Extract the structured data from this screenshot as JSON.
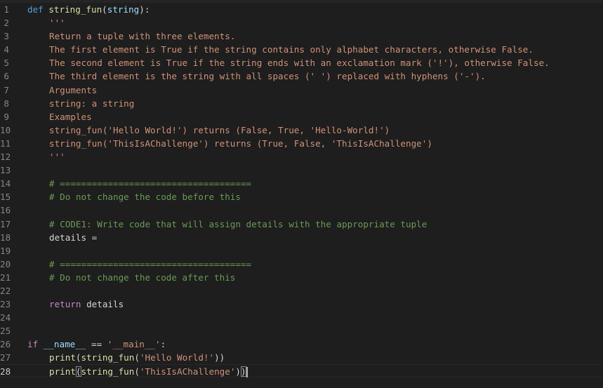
{
  "editor": {
    "language": "python",
    "active_line": 28,
    "colors": {
      "background": "#1e1e1e",
      "keyword": "#569cd6",
      "control_keyword": "#c586c0",
      "function": "#dcdcaa",
      "parameter": "#9cdcfe",
      "string": "#ce9178",
      "comment": "#6a9955",
      "line_number": "#858585"
    }
  },
  "lines": [
    {
      "num": "1",
      "t": {
        "kw": "def",
        "fn": "string_fun",
        "p1": "(",
        "param": "string",
        "p2": "):"
      }
    },
    {
      "num": "2",
      "t": {
        "s": "'''"
      }
    },
    {
      "num": "3",
      "t": {
        "s": "Return a tuple with three elements."
      }
    },
    {
      "num": "4",
      "t": {
        "s": "The first element is True if the string contains only alphabet characters, otherwise False."
      }
    },
    {
      "num": "5",
      "t": {
        "s": "The second element is True if the string ends with an exclamation mark ('!'), otherwise False."
      }
    },
    {
      "num": "6",
      "t": {
        "s": "The third element is the string with all spaces (' ') replaced with hyphens ('-')."
      }
    },
    {
      "num": "7",
      "t": {
        "s": "Arguments"
      }
    },
    {
      "num": "8",
      "t": {
        "s": "string: a string"
      }
    },
    {
      "num": "9",
      "t": {
        "s": "Examples"
      }
    },
    {
      "num": "10",
      "t": {
        "s": "string_fun('Hello World!') returns (False, True, 'Hello-World!')"
      }
    },
    {
      "num": "11",
      "t": {
        "s": "string_fun('ThisIsAChallenge') returns (True, False, 'ThisIsAChallenge')"
      }
    },
    {
      "num": "12",
      "t": {
        "s": "'''"
      }
    },
    {
      "num": "13",
      "t": {}
    },
    {
      "num": "14",
      "t": {
        "c": "# ===================================="
      }
    },
    {
      "num": "15",
      "t": {
        "c": "# Do not change the code before this"
      }
    },
    {
      "num": "16",
      "t": {}
    },
    {
      "num": "17",
      "t": {
        "c": "# CODE1: Write code that will assign details with the appropriate tuple"
      }
    },
    {
      "num": "18",
      "t": {
        "var": "details",
        "op": " ="
      }
    },
    {
      "num": "19",
      "t": {}
    },
    {
      "num": "20",
      "t": {
        "c": "# ===================================="
      }
    },
    {
      "num": "21",
      "t": {
        "c": "# Do not change the code after this"
      }
    },
    {
      "num": "22",
      "t": {}
    },
    {
      "num": "23",
      "t": {
        "kw": "return",
        "var": "details"
      }
    },
    {
      "num": "24",
      "t": {}
    },
    {
      "num": "25",
      "t": {}
    },
    {
      "num": "26",
      "t": {
        "kw": "if",
        "var": "__name__",
        "op": "==",
        "s": "'__main__'",
        "end": ":"
      }
    },
    {
      "num": "27",
      "t": {
        "fn1": "print",
        "fn2": "string_fun",
        "s": "'Hello World!'"
      }
    },
    {
      "num": "28",
      "t": {
        "fn1": "print",
        "fn2": "string_fun",
        "s": "'ThisIsAChallenge'"
      }
    }
  ]
}
